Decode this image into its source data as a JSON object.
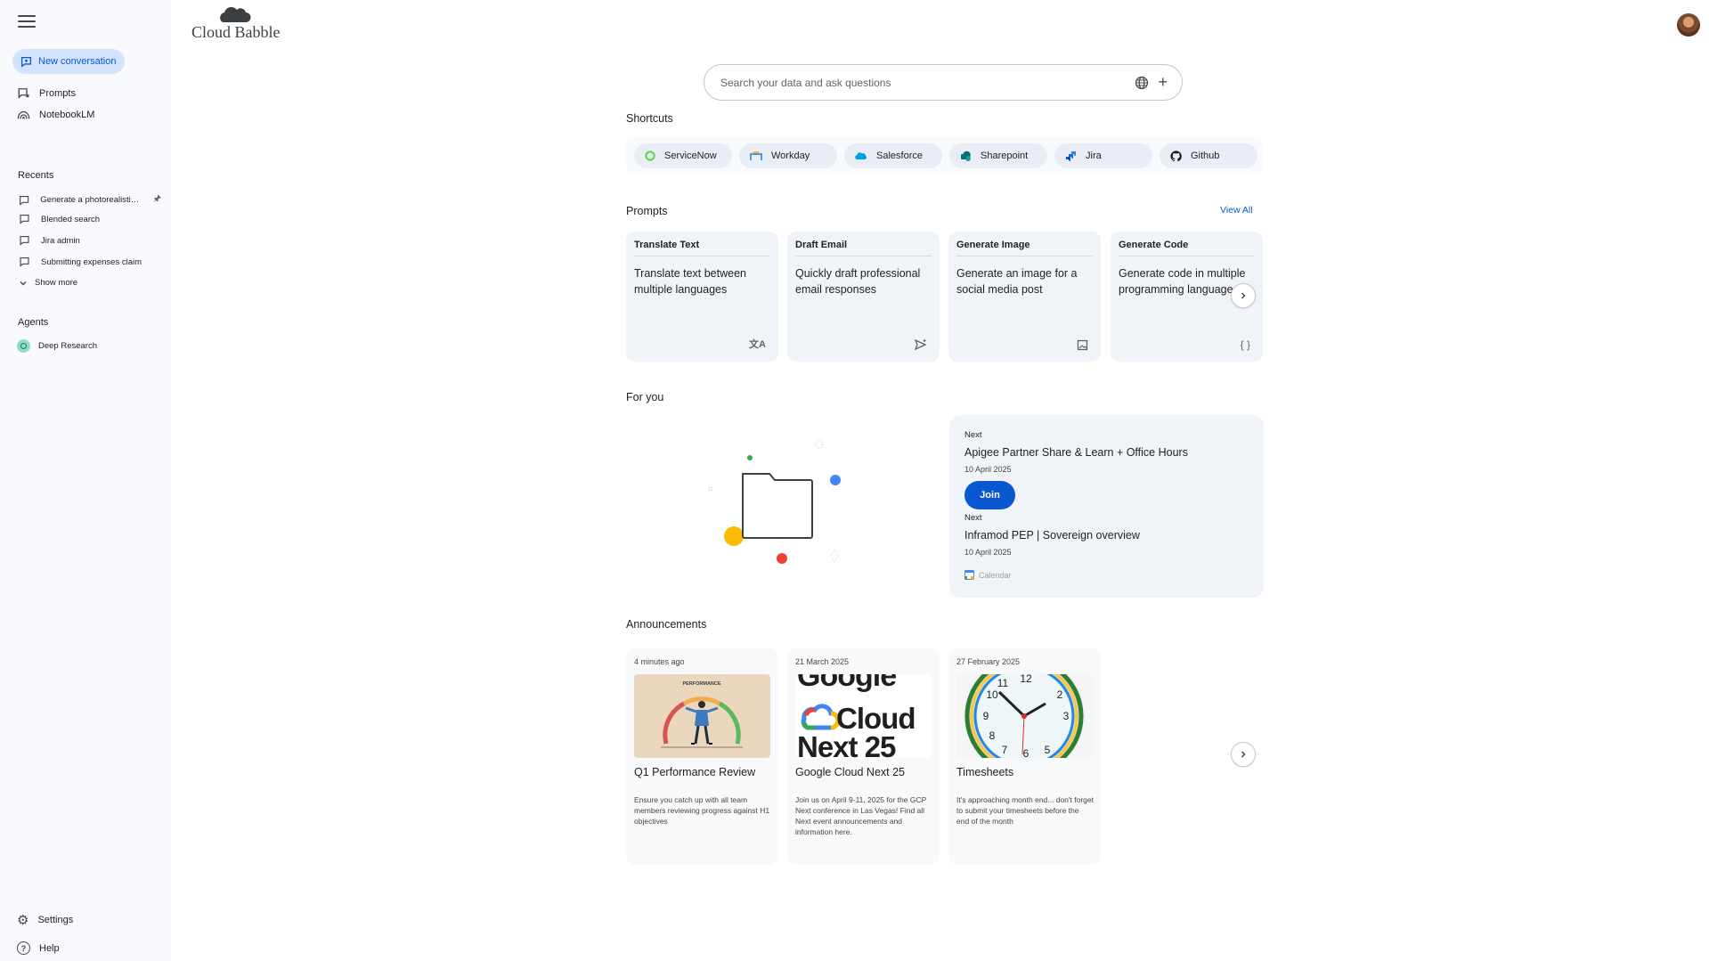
{
  "app": {
    "name": "Cloud Babble"
  },
  "sidebar": {
    "new_conversation": "New conversation",
    "nav": [
      {
        "label": "Prompts",
        "icon": "prompt-icon"
      },
      {
        "label": "NotebookLM",
        "icon": "notebooklm-icon"
      }
    ],
    "recents_heading": "Recents",
    "recents": [
      {
        "label": "Generate a photorealistic i...",
        "pinned": true
      },
      {
        "label": "Blended search"
      },
      {
        "label": "Jira admin"
      },
      {
        "label": "Submitting expenses claim"
      }
    ],
    "show_more": "Show more",
    "agents_heading": "Agents",
    "agents": [
      {
        "label": "Deep Research"
      }
    ],
    "settings": "Settings",
    "help": "Help"
  },
  "search": {
    "placeholder": "Search your data and ask questions"
  },
  "shortcuts": {
    "heading": "Shortcuts",
    "items": [
      {
        "label": "ServiceNow",
        "icon": "servicenow-icon",
        "color": "#62d84e"
      },
      {
        "label": "Workday",
        "icon": "workday-icon",
        "color": "#0875e1"
      },
      {
        "label": "Salesforce",
        "icon": "salesforce-icon",
        "color": "#00a1e0"
      },
      {
        "label": "Sharepoint",
        "icon": "sharepoint-icon",
        "color": "#036c70"
      },
      {
        "label": "Jira",
        "icon": "jira-icon",
        "color": "#2684ff"
      },
      {
        "label": "Github",
        "icon": "github-icon",
        "color": "#181717"
      }
    ]
  },
  "prompts": {
    "heading": "Prompts",
    "view_all": "View All",
    "cards": [
      {
        "title": "Translate Text",
        "desc": "Translate text between multiple languages",
        "icon": "translate-icon"
      },
      {
        "title": "Draft Email",
        "desc": "Quickly draft professional email responses",
        "icon": "send-icon"
      },
      {
        "title": "Generate Image",
        "desc": "Generate an image for a social media post",
        "icon": "image-icon"
      },
      {
        "title": "Generate Code",
        "desc": "Generate code in multiple programming languages",
        "icon": "code-icon"
      }
    ]
  },
  "for_you": {
    "heading": "For you",
    "events": [
      {
        "label": "Next",
        "title": "Apigee Partner Share & Learn + Office Hours",
        "date": "10 April 2025",
        "action": "Join"
      },
      {
        "label": "Next",
        "title": "Inframod PEP | Sovereign overview",
        "date": "10 April 2025"
      }
    ],
    "source": "Calendar"
  },
  "announcements": {
    "heading": "Announcements",
    "items": [
      {
        "date": "4 minutes ago",
        "title": "Q1 Performance Review",
        "desc": "Ensure you catch up with all team members reviewing progress against H1 objectives",
        "image_caption": "PERFORMANCE"
      },
      {
        "date": "21 March 2025",
        "title": "Google Cloud Next 25",
        "desc": "Join us on April 9-11, 2025 for the GCP Next conference in Las Vegas! Find all Next event announcements and information here.",
        "image_text": [
          "Google",
          "Cloud",
          "Next 25"
        ]
      },
      {
        "date": "27 February 2025",
        "title": "Timesheets",
        "desc": "It's approaching month end... don't forget to submit your timesheets before the end of the month",
        "clock_numbers": [
          "12",
          "11",
          "10",
          "9",
          "8",
          "7",
          "6",
          "5",
          "3",
          "2"
        ]
      }
    ]
  },
  "colors": {
    "accent": "#0b57d0",
    "chip_bg": "#e9eef6",
    "card_bg": "#f0f4f9",
    "sidebar_bg": "#f8fafd"
  }
}
